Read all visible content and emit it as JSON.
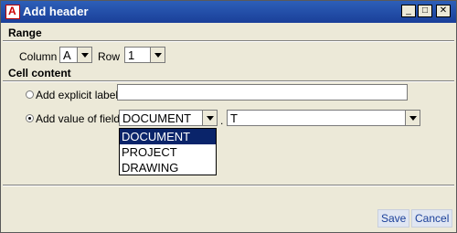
{
  "window": {
    "title": "Add header"
  },
  "titlebar": {
    "min": "_",
    "max": "□",
    "close": "✕"
  },
  "range": {
    "section_label": "Range",
    "column_label": "Column",
    "column_value": "A",
    "row_label": "Row",
    "row_value": "1"
  },
  "cell": {
    "section_label": "Cell content",
    "explicit_label": "Add explicit label",
    "explicit_value": "",
    "field_label": "Add value of field",
    "field_value": "DOCUMENT",
    "separator": ".",
    "attribute_value": "T",
    "selected_radio": "value_of_field",
    "dropdown_options": [
      "DOCUMENT",
      "PROJECT",
      "DRAWING"
    ],
    "dropdown_selected": "DOCUMENT"
  },
  "footer": {
    "save_label": "Save",
    "cancel_label": "Cancel"
  }
}
